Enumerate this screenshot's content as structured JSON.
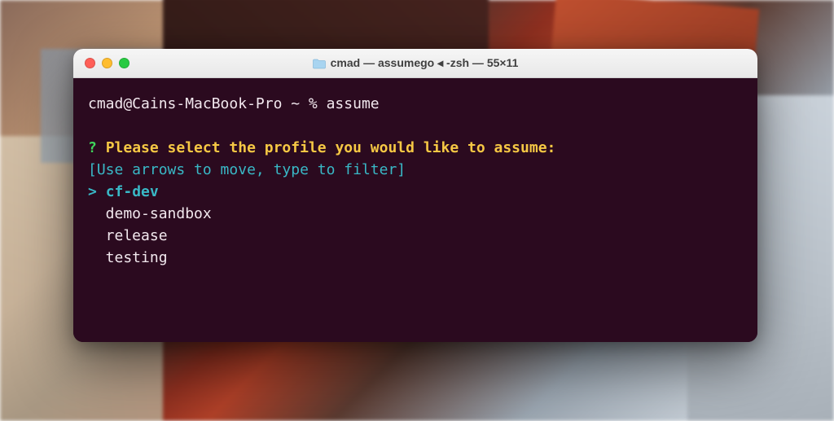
{
  "window": {
    "title_folder": "cmad",
    "title_process": "assumego",
    "title_separator": "◂",
    "title_shell": "-zsh",
    "title_dims": "55×11"
  },
  "terminal": {
    "prompt": "cmad@Cains-MacBook-Pro ~ % assume",
    "question_marker": "?",
    "question_text": "Please select the profile you would like to assume:",
    "hint": "[Use arrows to move, type to filter]",
    "selected_marker": ">",
    "options": [
      {
        "label": "cf-dev",
        "selected": true
      },
      {
        "label": "demo-sandbox",
        "selected": false
      },
      {
        "label": "release",
        "selected": false
      },
      {
        "label": "testing",
        "selected": false
      }
    ]
  },
  "colors": {
    "terminal_bg": "#2b0a1f",
    "text": "#f2e8ee",
    "green": "#3fd65c",
    "yellow": "#f6c844",
    "cyan": "#39b8c6"
  }
}
